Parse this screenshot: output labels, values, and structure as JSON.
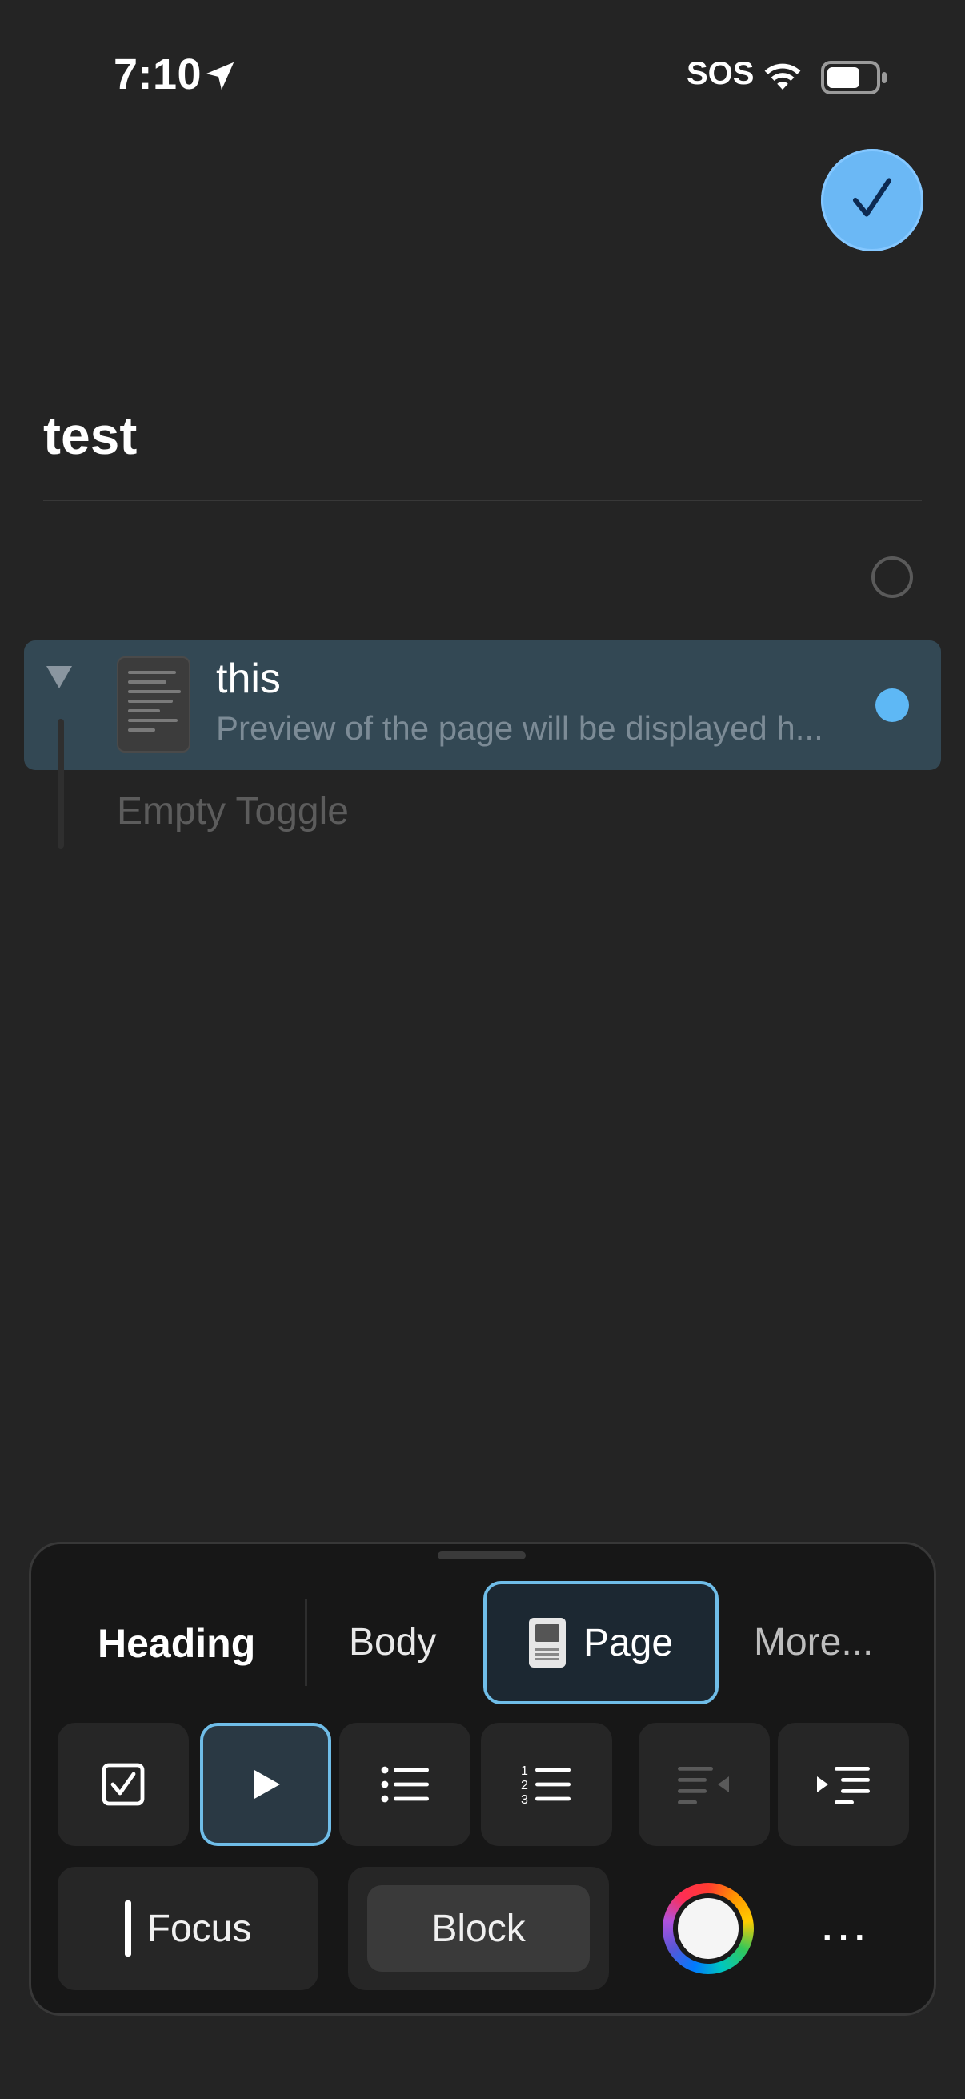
{
  "status_bar": {
    "time": "7:10",
    "carrier": "SOS"
  },
  "document": {
    "title": "test",
    "selected_block": {
      "title": "this",
      "preview": "Preview of the page will be displayed h..."
    },
    "empty_toggle_placeholder": "Empty Toggle"
  },
  "toolbar": {
    "segments": {
      "heading": "Heading",
      "body": "Body",
      "page": "Page",
      "more": "More..."
    },
    "focus_label": "Focus",
    "block_label": "Block",
    "more_icon": "…"
  },
  "colors": {
    "background": "#242424",
    "accent": "#6fbde8",
    "selected_row": "#334854",
    "done_button": "#6bb8f5"
  }
}
